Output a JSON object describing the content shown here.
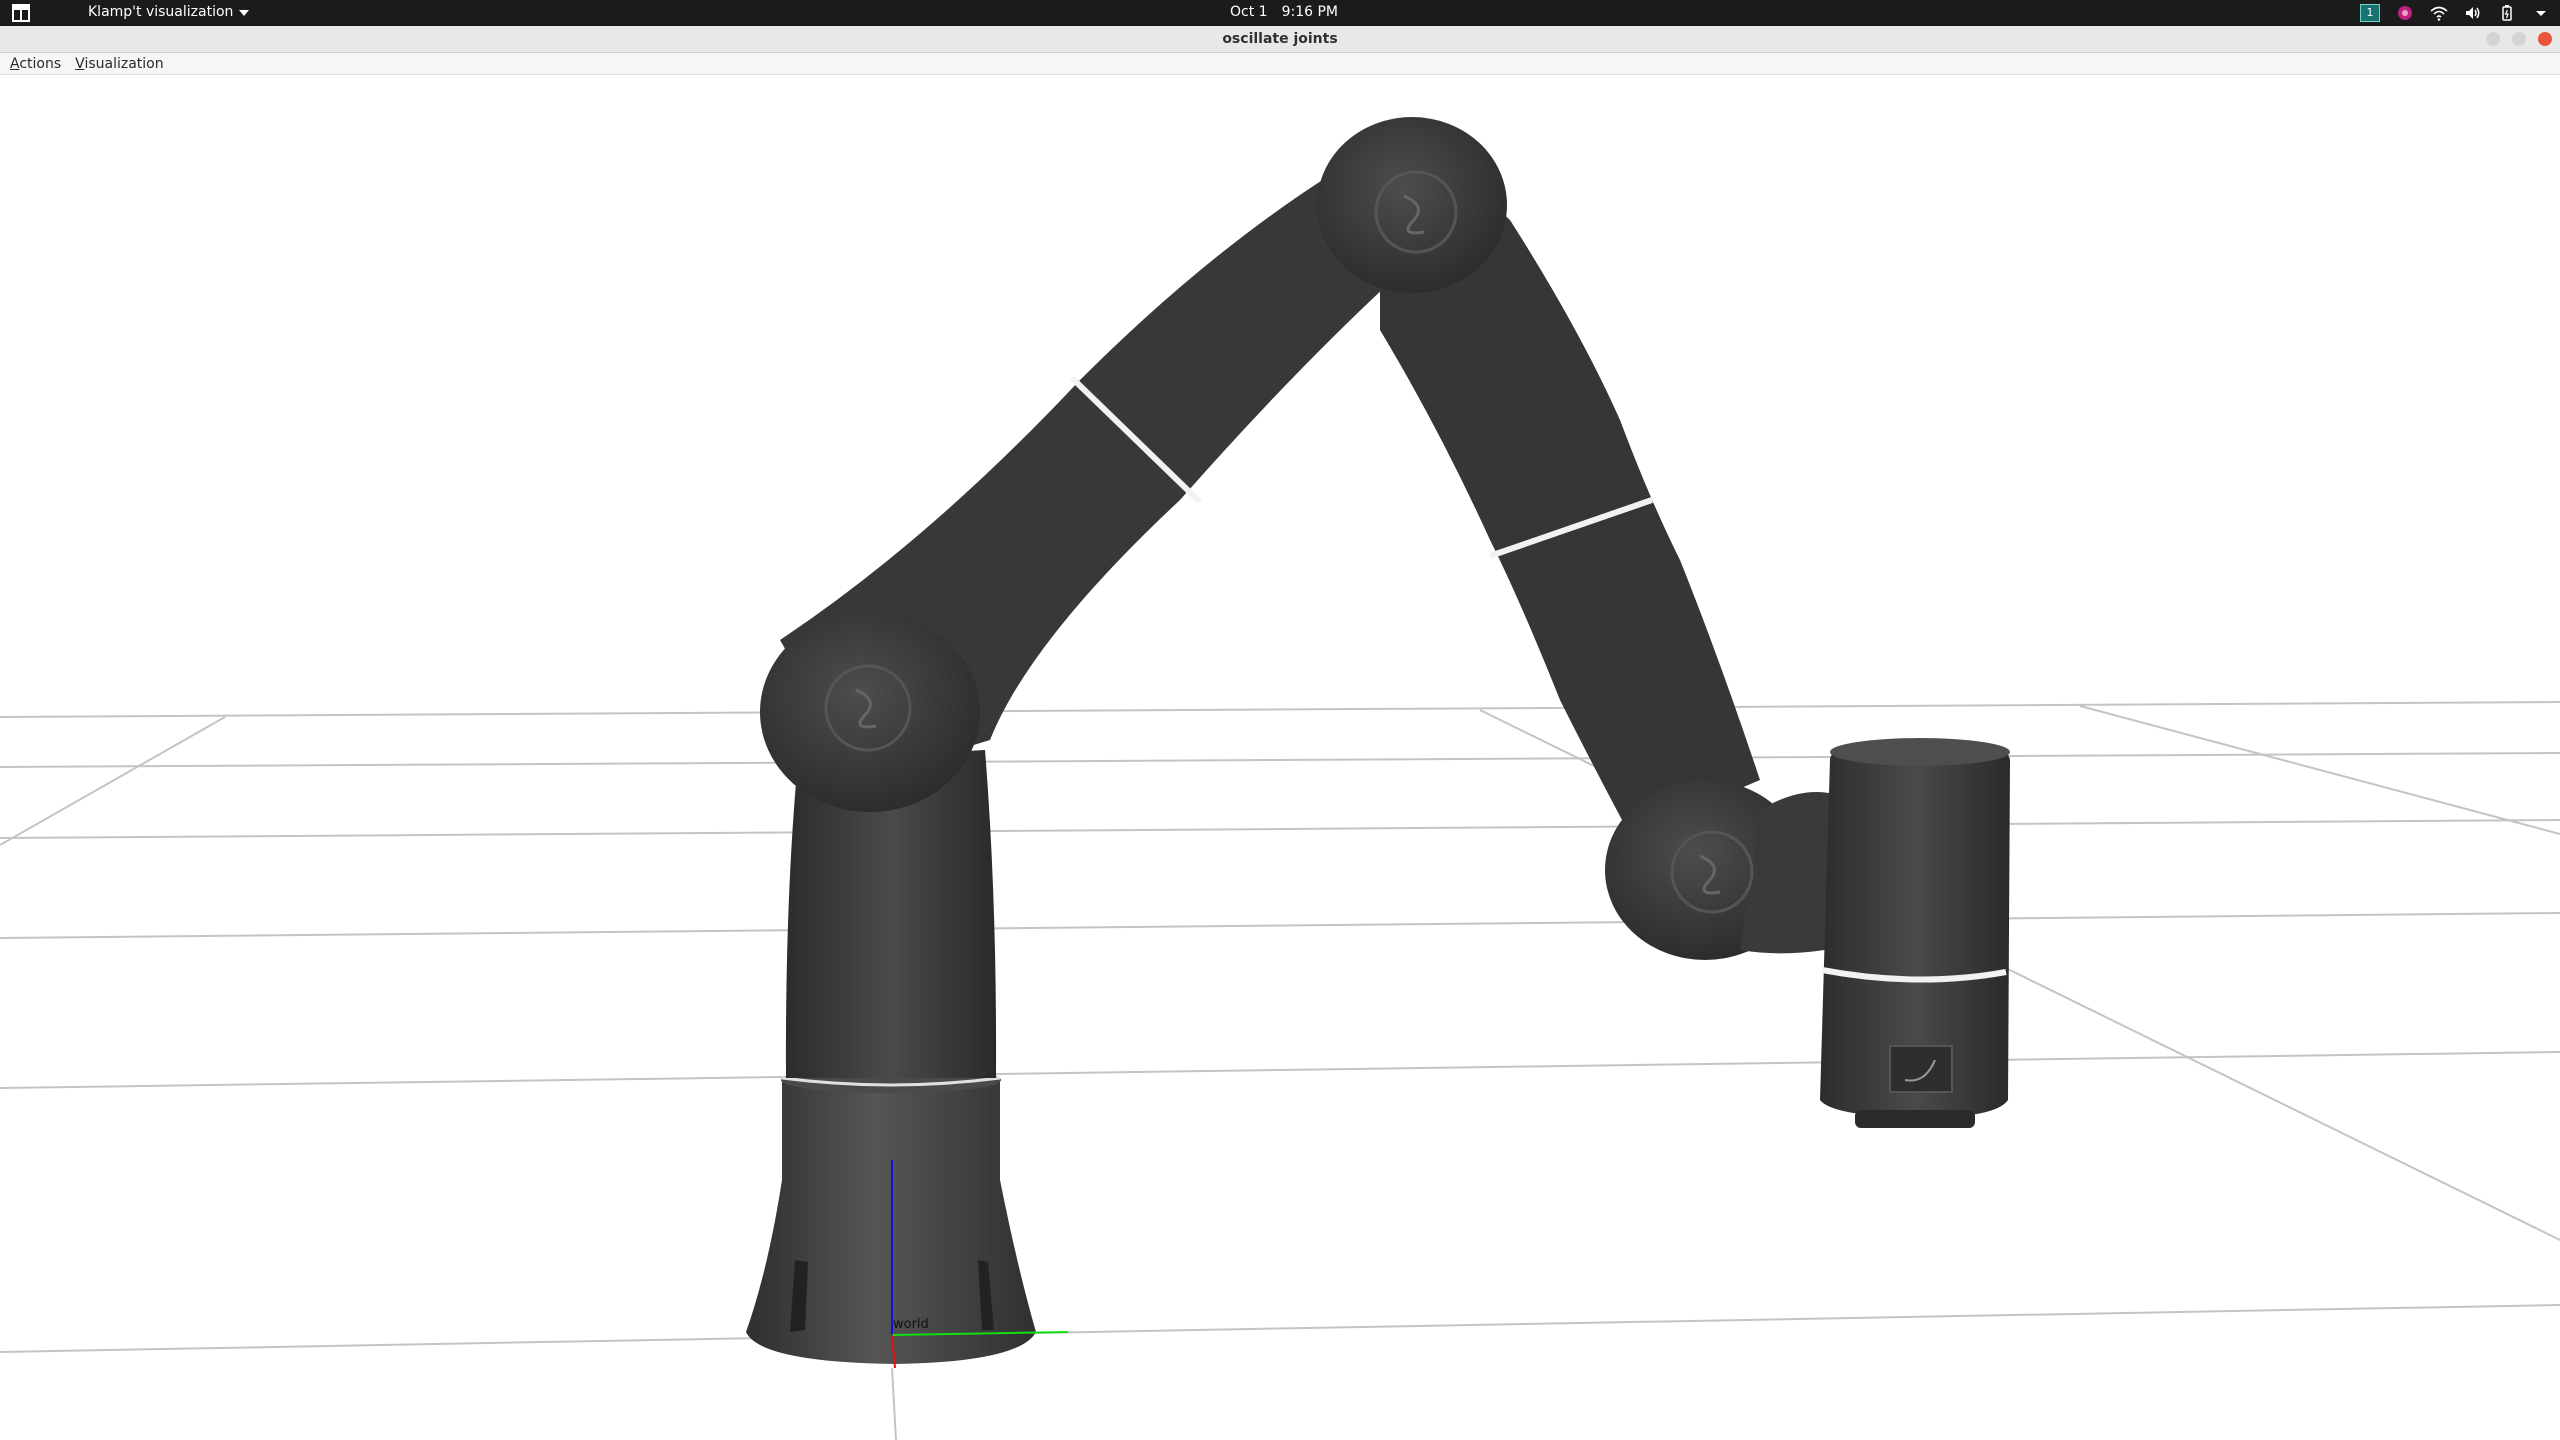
{
  "topbar": {
    "app_menu_label": "Klamp't visualization",
    "date": "Oct 1",
    "time": "9:16 PM",
    "workspace_number": "1",
    "icons": [
      "activities-icon",
      "workspace-indicator",
      "app-indicator-icon",
      "wifi-icon",
      "volume-icon",
      "battery-icon",
      "system-menu-caret-icon"
    ]
  },
  "window": {
    "title": "oscillate joints",
    "close_color": "#e9553a"
  },
  "menubar": {
    "actions": {
      "first": "A",
      "rest": "ctions"
    },
    "visualization": {
      "first": "V",
      "rest": "isualization"
    }
  },
  "scene": {
    "frame_label": "world",
    "axis_colors": {
      "x": "#e01010",
      "y": "#10e010",
      "z": "#1010e0"
    },
    "robot_color": "#3a3a3a"
  }
}
